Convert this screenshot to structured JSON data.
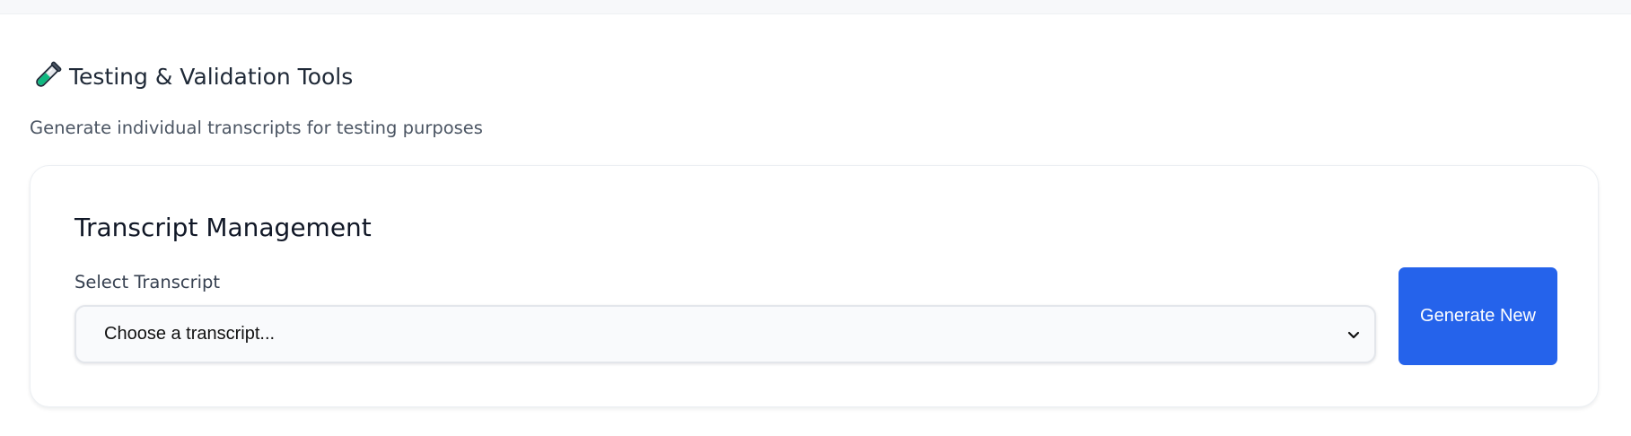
{
  "section": {
    "icon": "test-tube-icon",
    "title": "Testing & Validation Tools",
    "subtitle": "Generate individual transcripts for testing purposes"
  },
  "card": {
    "title": "Transcript Management",
    "select_label": "Select Transcript",
    "select_value": "Choose a transcript...",
    "select_icon": "chevron-down-icon",
    "generate_label": "Generate New"
  },
  "colors": {
    "accent": "#2563eb",
    "title_text": "#111827",
    "muted_text": "#4b5563",
    "icon_teal": "#10b981"
  }
}
